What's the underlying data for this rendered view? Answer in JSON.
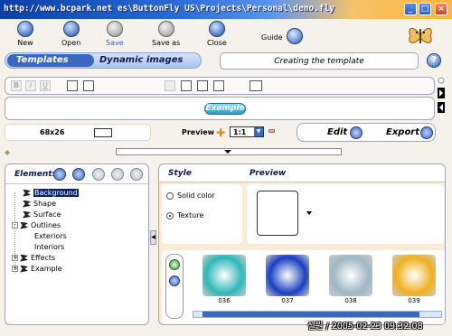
{
  "window": {
    "title": "http://www.bcpark.net es\\ButtonFly US\\Projects\\Personal\\demo.fly",
    "minimize": "_",
    "maximize": "□",
    "close": "×"
  },
  "toolbar": {
    "new_label": "New",
    "open_label": "Open",
    "save_label": "Save",
    "save_as_label": "Save as",
    "close_label": "Close",
    "guide_label": "Guide"
  },
  "tabs": {
    "templates": "Templates",
    "dynamic_images": "Dynamic images"
  },
  "step_title": "Creating the template",
  "help_label": "?",
  "format": {
    "bold": "B",
    "italic": "I",
    "underline": "U"
  },
  "example_button": "Example",
  "size_label": "68x26",
  "preview_label": "Preview",
  "zoom_value": "1:1",
  "edit_label": "Edit",
  "export_label": "Export",
  "elements": {
    "title": "Elements",
    "tree": [
      {
        "label": "Background",
        "selected": true
      },
      {
        "label": "Shape"
      },
      {
        "label": "Surface"
      },
      {
        "label": "Outlines",
        "expand": "-"
      },
      {
        "label": "Exteriors"
      },
      {
        "label": "Interiors"
      },
      {
        "label": "Effects",
        "expand": "+"
      },
      {
        "label": "Example",
        "expand": "+"
      }
    ]
  },
  "style": {
    "style_header": "Style",
    "preview_header": "Preview",
    "solid_color": "Solid color",
    "texture": "Texture"
  },
  "textures": [
    {
      "id": "036",
      "color": "#2fb7b7"
    },
    {
      "id": "037",
      "color": "#1a3fbf"
    },
    {
      "id": "038",
      "color": "#9fb6c4"
    },
    {
      "id": "039",
      "color": "#f0b020"
    }
  ],
  "watermark": "설원 / 2005-02-23 09:32:08"
}
